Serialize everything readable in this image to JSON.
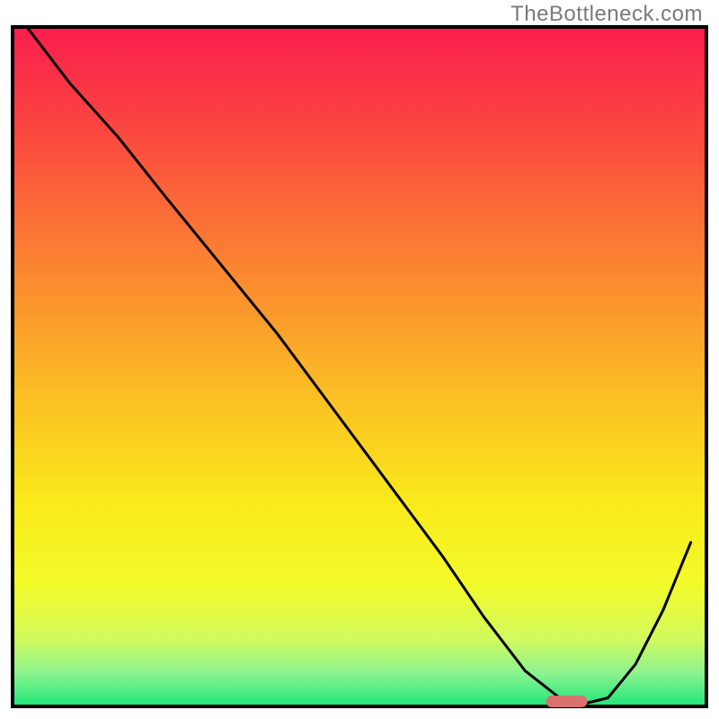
{
  "attribution": "TheBottleneck.com",
  "chart_data": {
    "type": "line",
    "title": "",
    "xlabel": "",
    "ylabel": "",
    "xlim": [
      0,
      100
    ],
    "ylim": [
      0,
      100
    ],
    "series": [
      {
        "name": "curve",
        "x": [
          2,
          8,
          15,
          22,
          30,
          38,
          46,
          54,
          62,
          68,
          74,
          79,
          82,
          86,
          90,
          94,
          98
        ],
        "y": [
          100,
          92,
          84,
          75,
          65,
          55,
          44,
          33,
          22,
          13,
          5,
          1,
          0,
          1,
          6,
          14,
          24
        ]
      }
    ],
    "marker": {
      "name": "optimal-point",
      "x": 80,
      "y": 0,
      "width": 6,
      "color": "#d9716f"
    },
    "gradient_stops": [
      {
        "offset": 0.0,
        "color": "#fa1e4e"
      },
      {
        "offset": 0.15,
        "color": "#fb4640"
      },
      {
        "offset": 0.35,
        "color": "#fb8431"
      },
      {
        "offset": 0.55,
        "color": "#fbc123"
      },
      {
        "offset": 0.7,
        "color": "#faea1b"
      },
      {
        "offset": 0.82,
        "color": "#f3fa2a"
      },
      {
        "offset": 0.9,
        "color": "#d2fa5d"
      },
      {
        "offset": 0.95,
        "color": "#8ef38f"
      },
      {
        "offset": 1.0,
        "color": "#1ee67a"
      }
    ],
    "border_color": "#000000",
    "border_width": 4
  }
}
